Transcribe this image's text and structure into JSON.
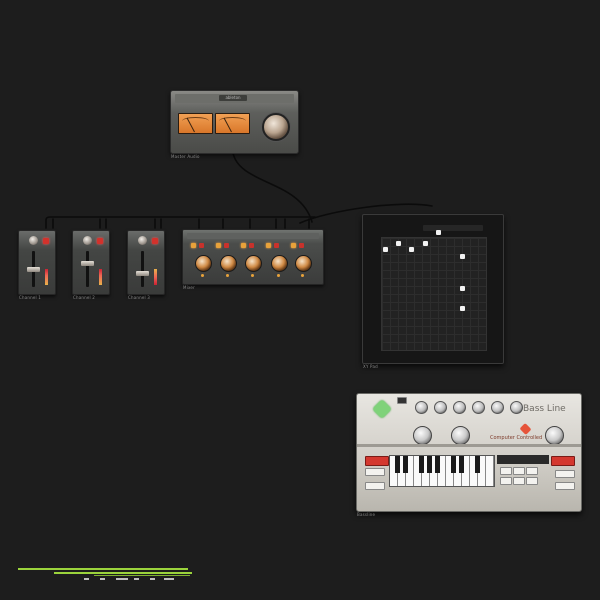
{
  "master": {
    "brand": "ableton",
    "label": "Master Audio"
  },
  "strips": [
    {
      "name": "Channel 1"
    },
    {
      "name": "Channel 2"
    },
    {
      "name": "Channel 3"
    }
  ],
  "rack": {
    "label": "Mixer"
  },
  "xypad": {
    "label": "XY Pad"
  },
  "bassline": {
    "title": "Bass Line",
    "subtitle": "Computer Controlled",
    "label": "Bassline"
  },
  "colors": {
    "background": "#1d1d1d",
    "vu": "#e98a3c",
    "accent_green": "#9bd33c",
    "led_red": "#d2322c",
    "led_amber": "#e8a23a"
  }
}
